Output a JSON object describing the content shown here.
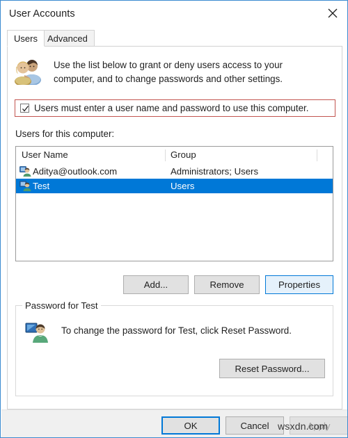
{
  "window": {
    "title": "User Accounts",
    "close_icon": "close-icon",
    "border_color": "#3b8bd0"
  },
  "tabs": [
    {
      "label": "Users",
      "active": true
    },
    {
      "label": "Advanced",
      "active": false
    }
  ],
  "intro": {
    "icon": "two-users-icon",
    "text": "Use the list below to grant or deny users access to your computer, and to change passwords and other settings."
  },
  "require_password_checkbox": {
    "label": "Users must enter a user name and password to use this computer.",
    "checked": true,
    "highlight_color": "#c2544f"
  },
  "users_list": {
    "label": "Users for this computer:",
    "columns": [
      "User Name",
      "Group"
    ],
    "rows": [
      {
        "icon": "user-account-icon",
        "user_name": "Aditya@outlook.com",
        "group": "Administrators; Users",
        "selected": false
      },
      {
        "icon": "user-account-icon",
        "user_name": "Test",
        "group": "Users",
        "selected": true
      }
    ],
    "selection_color": "#0078d7"
  },
  "list_buttons": {
    "add": "Add...",
    "remove": "Remove",
    "properties": "Properties"
  },
  "password_group": {
    "title": "Password for Test",
    "icon": "user-password-icon",
    "text": "To change the password for Test, click Reset Password.",
    "reset_button": "Reset Password..."
  },
  "footer": {
    "ok": "OK",
    "cancel": "Cancel",
    "apply": "Apply",
    "apply_disabled": true
  },
  "watermark": "wsxdn.com"
}
